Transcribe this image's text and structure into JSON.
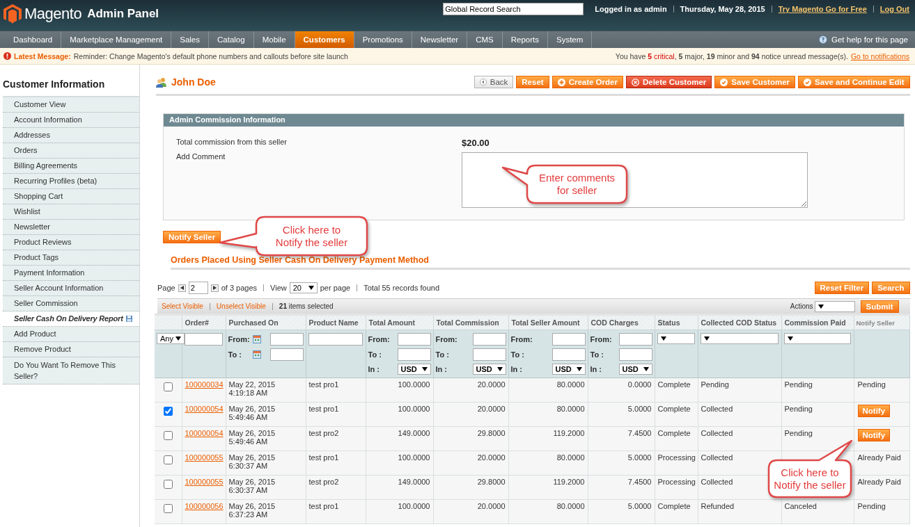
{
  "header": {
    "logo_name": "Magento",
    "logo_suffix": "Admin Panel",
    "search_value": "Global Record Search",
    "user": "Logged in as admin",
    "date": "Thursday, May 28, 2015",
    "links": [
      "Try Magento Go for Free",
      "Log Out"
    ]
  },
  "nav": {
    "items": [
      {
        "label": "Dashboard",
        "selected": false
      },
      {
        "label": "Marketplace Management",
        "selected": false
      },
      {
        "label": "Sales",
        "selected": false
      },
      {
        "label": "Catalog",
        "selected": false
      },
      {
        "label": "Mobile",
        "selected": false
      },
      {
        "label": "Customers",
        "selected": true
      },
      {
        "label": "Promotions",
        "selected": false
      },
      {
        "label": "Newsletter",
        "selected": false
      },
      {
        "label": "CMS",
        "selected": false
      },
      {
        "label": "Reports",
        "selected": false
      },
      {
        "label": "System",
        "selected": false
      }
    ],
    "help": "Get help for this page"
  },
  "message": {
    "label": "Latest Message:",
    "text": "Reminder: Change Magento's default phone numbers and callouts before site launch",
    "summary_before": "You have",
    "summary_critical": "**5** critical",
    "summary_after": ", **5** major, **19** minor and **94** notice unread message(s).",
    "link": "Go to notifications"
  },
  "sidebar": {
    "title": "Customer Information",
    "items": [
      {
        "label": "Customer View",
        "selected": false
      },
      {
        "label": "Account Information",
        "selected": false
      },
      {
        "label": "Addresses",
        "selected": false
      },
      {
        "label": "Orders",
        "selected": false
      },
      {
        "label": "Billing Agreements",
        "selected": false
      },
      {
        "label": "Recurring Profiles (beta)",
        "selected": false
      },
      {
        "label": "Shopping Cart",
        "selected": false
      },
      {
        "label": "Wishlist",
        "selected": false
      },
      {
        "label": "Newsletter",
        "selected": false
      },
      {
        "label": "Product Reviews",
        "selected": false
      },
      {
        "label": "Product Tags",
        "selected": false
      },
      {
        "label": "Payment Information",
        "selected": false
      },
      {
        "label": "Seller Account Information",
        "selected": false
      },
      {
        "label": "Seller Commission",
        "selected": false
      },
      {
        "label": "Seller Cash On Delivery Report",
        "selected": true
      },
      {
        "label": "Add Product",
        "selected": false
      },
      {
        "label": "Remove Product",
        "selected": false
      },
      {
        "label": "Do You Want To Remove This Seller?",
        "selected": false
      }
    ]
  },
  "page": {
    "title": "John Doe",
    "buttons": [
      {
        "label": "Back",
        "kind": "back"
      },
      {
        "label": "Reset",
        "kind": "plain"
      },
      {
        "label": "Create Order",
        "kind": "add"
      },
      {
        "label": "Delete Customer",
        "kind": "delete"
      },
      {
        "label": "Save Customer",
        "kind": "save"
      },
      {
        "label": "Save and Continue Edit",
        "kind": "save"
      }
    ]
  },
  "commission_panel": {
    "title": "Admin Commission Information",
    "commission_label": "Total commission from this seller",
    "commission_value": "$20.00",
    "comment_label": "Add Comment",
    "button": "Notify Seller"
  },
  "callouts": [
    {
      "lines": [
        "Enter comments",
        "for seller"
      ]
    },
    {
      "lines": [
        "Click here to",
        "Notify the seller"
      ]
    },
    {
      "lines": [
        "Click here to",
        "Notify the seller"
      ]
    }
  ],
  "orders": {
    "title": "Orders Placed Using Seller Cash On Delivery Payment Method",
    "pager": {
      "page_label": "Page",
      "page": "2",
      "of_pages": "of 3 pages",
      "view_label": "View",
      "per_page": "20",
      "per_page_label": "per page",
      "total": "Total 55 records found"
    },
    "buttons": [
      "Reset Filter",
      "Search"
    ],
    "massaction": {
      "select_visible": "Select Visible",
      "unselect_visible": "Unselect Visible",
      "selected_count": "**21** items selected",
      "actions_label": "Actions",
      "submit": "Submit"
    },
    "columns": [
      {
        "filter": {
          "kind": "select",
          "value": "Any"
        }
      },
      {
        "label": "Order#",
        "filter": {
          "kind": "text"
        }
      },
      {
        "label": "Purchased On",
        "filter": {
          "kind": "date",
          "from": "From:",
          "to": "To :"
        }
      },
      {
        "label": "Product Name",
        "filter": {
          "kind": "text"
        }
      },
      {
        "label": "Total Amount",
        "filter": {
          "kind": "range",
          "from": "From:",
          "to": "To :",
          "in": "In :",
          "currency": "USD"
        }
      },
      {
        "label": "Total Commission",
        "filter": {
          "kind": "range",
          "from": "From:",
          "to": "To :",
          "in": "In :",
          "currency": "USD"
        }
      },
      {
        "label": "Total Seller Amount",
        "filter": {
          "kind": "range",
          "from": "From:",
          "to": "To :",
          "in": "In :",
          "currency": "USD"
        }
      },
      {
        "label": "COD Charges",
        "filter": {
          "kind": "range",
          "from": "From:",
          "to": "To :",
          "in": "In :",
          "currency": "USD"
        }
      },
      {
        "label": "Status",
        "filter": {
          "kind": "select"
        }
      },
      {
        "label": "Collected COD Status",
        "filter": {
          "kind": "select"
        }
      },
      {
        "label": "Commission Paid",
        "filter": {
          "kind": "select"
        }
      },
      {
        "label": "Notify Seller",
        "filter": {
          "kind": "none"
        }
      }
    ],
    "rows": [
      {
        "checked": false,
        "order": "100000034",
        "purchased_on": "May 22, 2015 4:19:18 AM",
        "product_name": "test pro1",
        "total_amount": "100.0000",
        "total_commission": "20.0000",
        "total_seller_amount": "80.0000",
        "cod_charges": "0.0000",
        "status": "Complete",
        "collected_cod_status": "Pending",
        "commission_paid": "Pending",
        "notify": {
          "kind": "text",
          "label": "Pending"
        }
      },
      {
        "checked": true,
        "order": "100000054",
        "purchased_on": "May 26, 2015 5:49:46 AM",
        "product_name": "test pro1",
        "total_amount": "100.0000",
        "total_commission": "20.0000",
        "total_seller_amount": "80.0000",
        "cod_charges": "5.0000",
        "status": "Complete",
        "collected_cod_status": "Collected",
        "commission_paid": "Pending",
        "notify": {
          "kind": "button",
          "label": "Notify"
        }
      },
      {
        "checked": false,
        "order": "100000054",
        "purchased_on": "May 26, 2015 5:49:46 AM",
        "product_name": "test pro2",
        "total_amount": "149.0000",
        "total_commission": "29.8000",
        "total_seller_amount": "119.2000",
        "cod_charges": "7.4500",
        "status": "Complete",
        "collected_cod_status": "Collected",
        "commission_paid": "Pending",
        "notify": {
          "kind": "button",
          "label": "Notify"
        }
      },
      {
        "checked": false,
        "order": "100000055",
        "purchased_on": "May 26, 2015 6:30:37 AM",
        "product_name": "test pro1",
        "total_amount": "100.0000",
        "total_commission": "20.0000",
        "total_seller_amount": "80.0000",
        "cod_charges": "5.0000",
        "status": "Processing",
        "collected_cod_status": "Collected",
        "notify": {
          "kind": "text",
          "label": "Already Paid"
        }
      },
      {
        "checked": false,
        "order": "100000055",
        "purchased_on": "May 26, 2015 6:30:37 AM",
        "product_name": "test pro2",
        "total_amount": "149.0000",
        "total_commission": "29.8000",
        "total_seller_amount": "119.2000",
        "cod_charges": "7.4500",
        "status": "Processing",
        "collected_cod_status": "Collected",
        "notify": {
          "kind": "text",
          "label": "Already Paid"
        }
      },
      {
        "checked": false,
        "order": "100000056",
        "purchased_on": "May 26, 2015 6:37:23 AM",
        "product_name": "test pro1",
        "total_amount": "100.0000",
        "total_commission": "20.0000",
        "total_seller_amount": "80.0000",
        "cod_charges": "5.0000",
        "status": "Complete",
        "collected_cod_status": "Refunded",
        "commission_paid": "Canceled",
        "notify": {
          "kind": "text",
          "label": "Pending"
        }
      }
    ]
  }
}
